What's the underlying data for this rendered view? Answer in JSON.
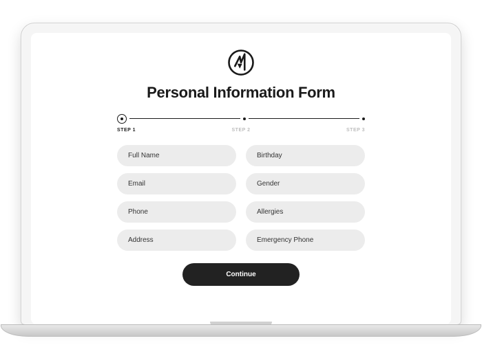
{
  "form": {
    "title": "Personal Information Form",
    "steps": {
      "step1": "STEP 1",
      "step2": "STEP 2",
      "step3": "STEP 3"
    },
    "fields": {
      "full_name": "Full Name",
      "birthday": "Birthday",
      "email": "Email",
      "gender": "Gender",
      "phone": "Phone",
      "allergies": "Allergies",
      "address": "Address",
      "emergency_phone": "Emergency Phone"
    },
    "continue_label": "Continue"
  }
}
